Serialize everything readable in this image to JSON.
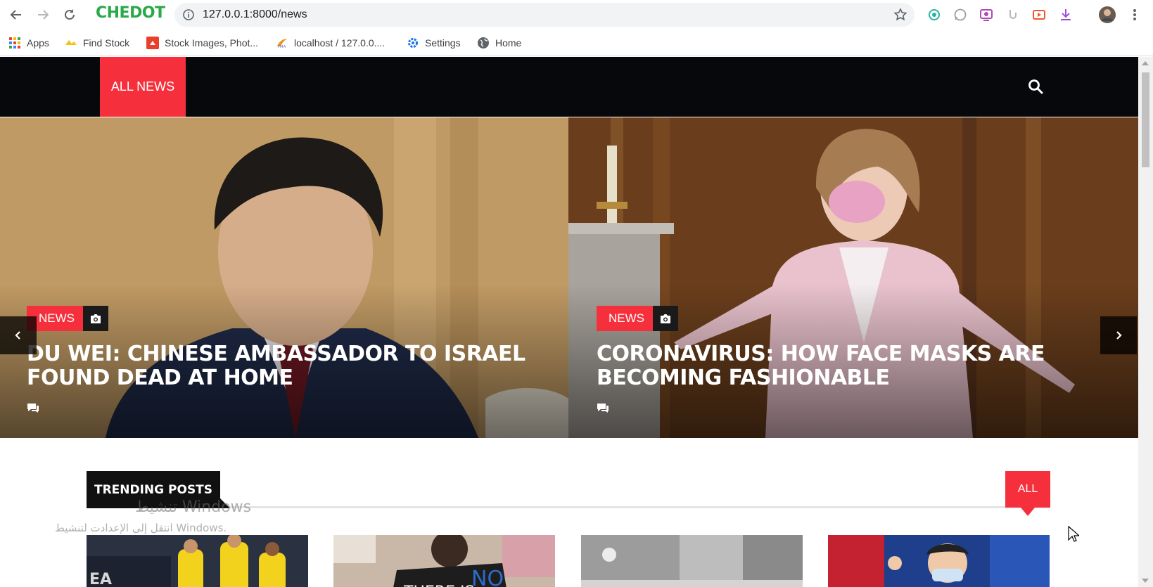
{
  "browser": {
    "brand": "CHEDOT",
    "url": "127.0.0.1:8000/news",
    "bookmarks": [
      {
        "label": "Apps",
        "icon": "apps-grid-icon"
      },
      {
        "label": "Find Stock",
        "icon": "find-stock-icon"
      },
      {
        "label": "Stock Images, Phot...",
        "icon": "stock-images-icon"
      },
      {
        "label": "localhost / 127.0.0....",
        "icon": "phpmyadmin-icon"
      },
      {
        "label": "Settings",
        "icon": "gear-icon"
      },
      {
        "label": "Home",
        "icon": "globe-icon"
      }
    ]
  },
  "site": {
    "nav_active": "ALL NEWS",
    "slides": [
      {
        "tag": "NEWS",
        "headline": "DU WEI: CHINESE AMBASSADOR TO ISRAEL FOUND DEAD AT HOME"
      },
      {
        "tag": "NEWS",
        "headline": "CORONAVIRUS: HOW FACE MASKS ARE BECOMING FASHIONABLE"
      }
    ],
    "section_title": "TRENDING POSTS",
    "all_label": "ALL"
  },
  "overlay": {
    "win_line1": "تنشيط Windows",
    "win_line2": "انتقل إلى الإعدادت لتنشيط Windows."
  },
  "colors": {
    "accent": "#f5303c",
    "nav_bg": "#07080c",
    "brand": "#2aa84a"
  }
}
